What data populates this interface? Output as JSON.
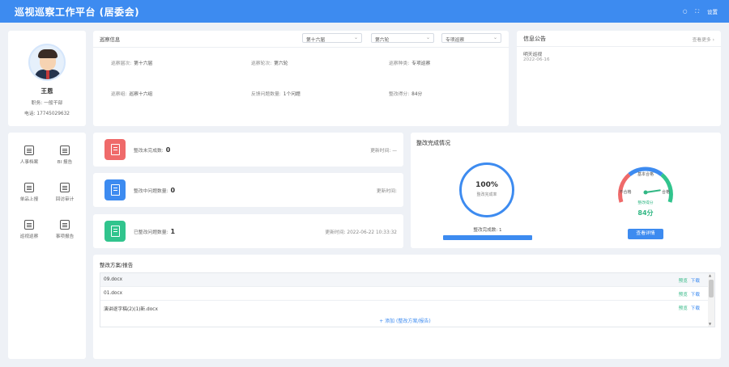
{
  "header": {
    "title": "巡视巡察工作平台 (居委会)",
    "settings_label": "设置"
  },
  "profile": {
    "name": "王恩",
    "position_label": "职务:",
    "position": "一般干部",
    "phone_label": "电话:",
    "phone": "17745029632"
  },
  "inspection": {
    "title": "巡察信息",
    "selects": [
      "第十六届",
      "第六轮",
      "专项巡察"
    ],
    "fields": [
      {
        "label": "巡察届次:",
        "value": "第十六届"
      },
      {
        "label": "巡察轮次:",
        "value": "第六轮"
      },
      {
        "label": "巡察种类:",
        "value": "专项巡察"
      },
      {
        "label": "巡察组:",
        "value": "巡察十六组"
      },
      {
        "label": "反馈问题数量:",
        "value": "1个问题"
      },
      {
        "label": "整改得分:",
        "value": "84分"
      }
    ]
  },
  "notice": {
    "title": "信息公告",
    "more": "查看更多",
    "items": [
      {
        "title": "明天巡视",
        "date": "2022-06-16"
      }
    ]
  },
  "menu": {
    "items": [
      "人事档案",
      "BI 报告",
      "单品上报",
      "回访审计",
      "巡视巡察",
      "事项报告"
    ]
  },
  "stats": [
    {
      "label": "整改未完成数:",
      "value": "0",
      "time_label": "更新时间:",
      "time": "—",
      "color": "#ef6a6a"
    },
    {
      "label": "整改中问题数量:",
      "value": "0",
      "time_label": "更新时间:",
      "time": "",
      "color": "#3d8bf0"
    },
    {
      "label": "已整改问题数量:",
      "value": "1",
      "time_label": "更新时间:",
      "time": "2022-06-22 10:33:32",
      "color": "#31c48d"
    }
  ],
  "rectification": {
    "title": "整改完成情况",
    "completion_pct": "100%",
    "completion_label": "整改完成率",
    "completed_label": "整改完成数: 1",
    "gauge_labels": {
      "top": "基本合格",
      "left": "不合格",
      "right": "合格",
      "sub": "整改得分"
    },
    "score": "84分",
    "score_fraction": 0.84,
    "detail_button": "查看详情"
  },
  "plans": {
    "title": "整改方案/报告",
    "files": [
      {
        "name": "09.docx",
        "preview": "预览",
        "download": "下载"
      },
      {
        "name": "01.docx",
        "preview": "预览",
        "download": "下载"
      },
      {
        "name": "演讲逐字稿(2)(1)新.docx",
        "preview": "预览",
        "download": "下载"
      }
    ],
    "add_label": "+ 添加 (整改方案/报告)"
  }
}
